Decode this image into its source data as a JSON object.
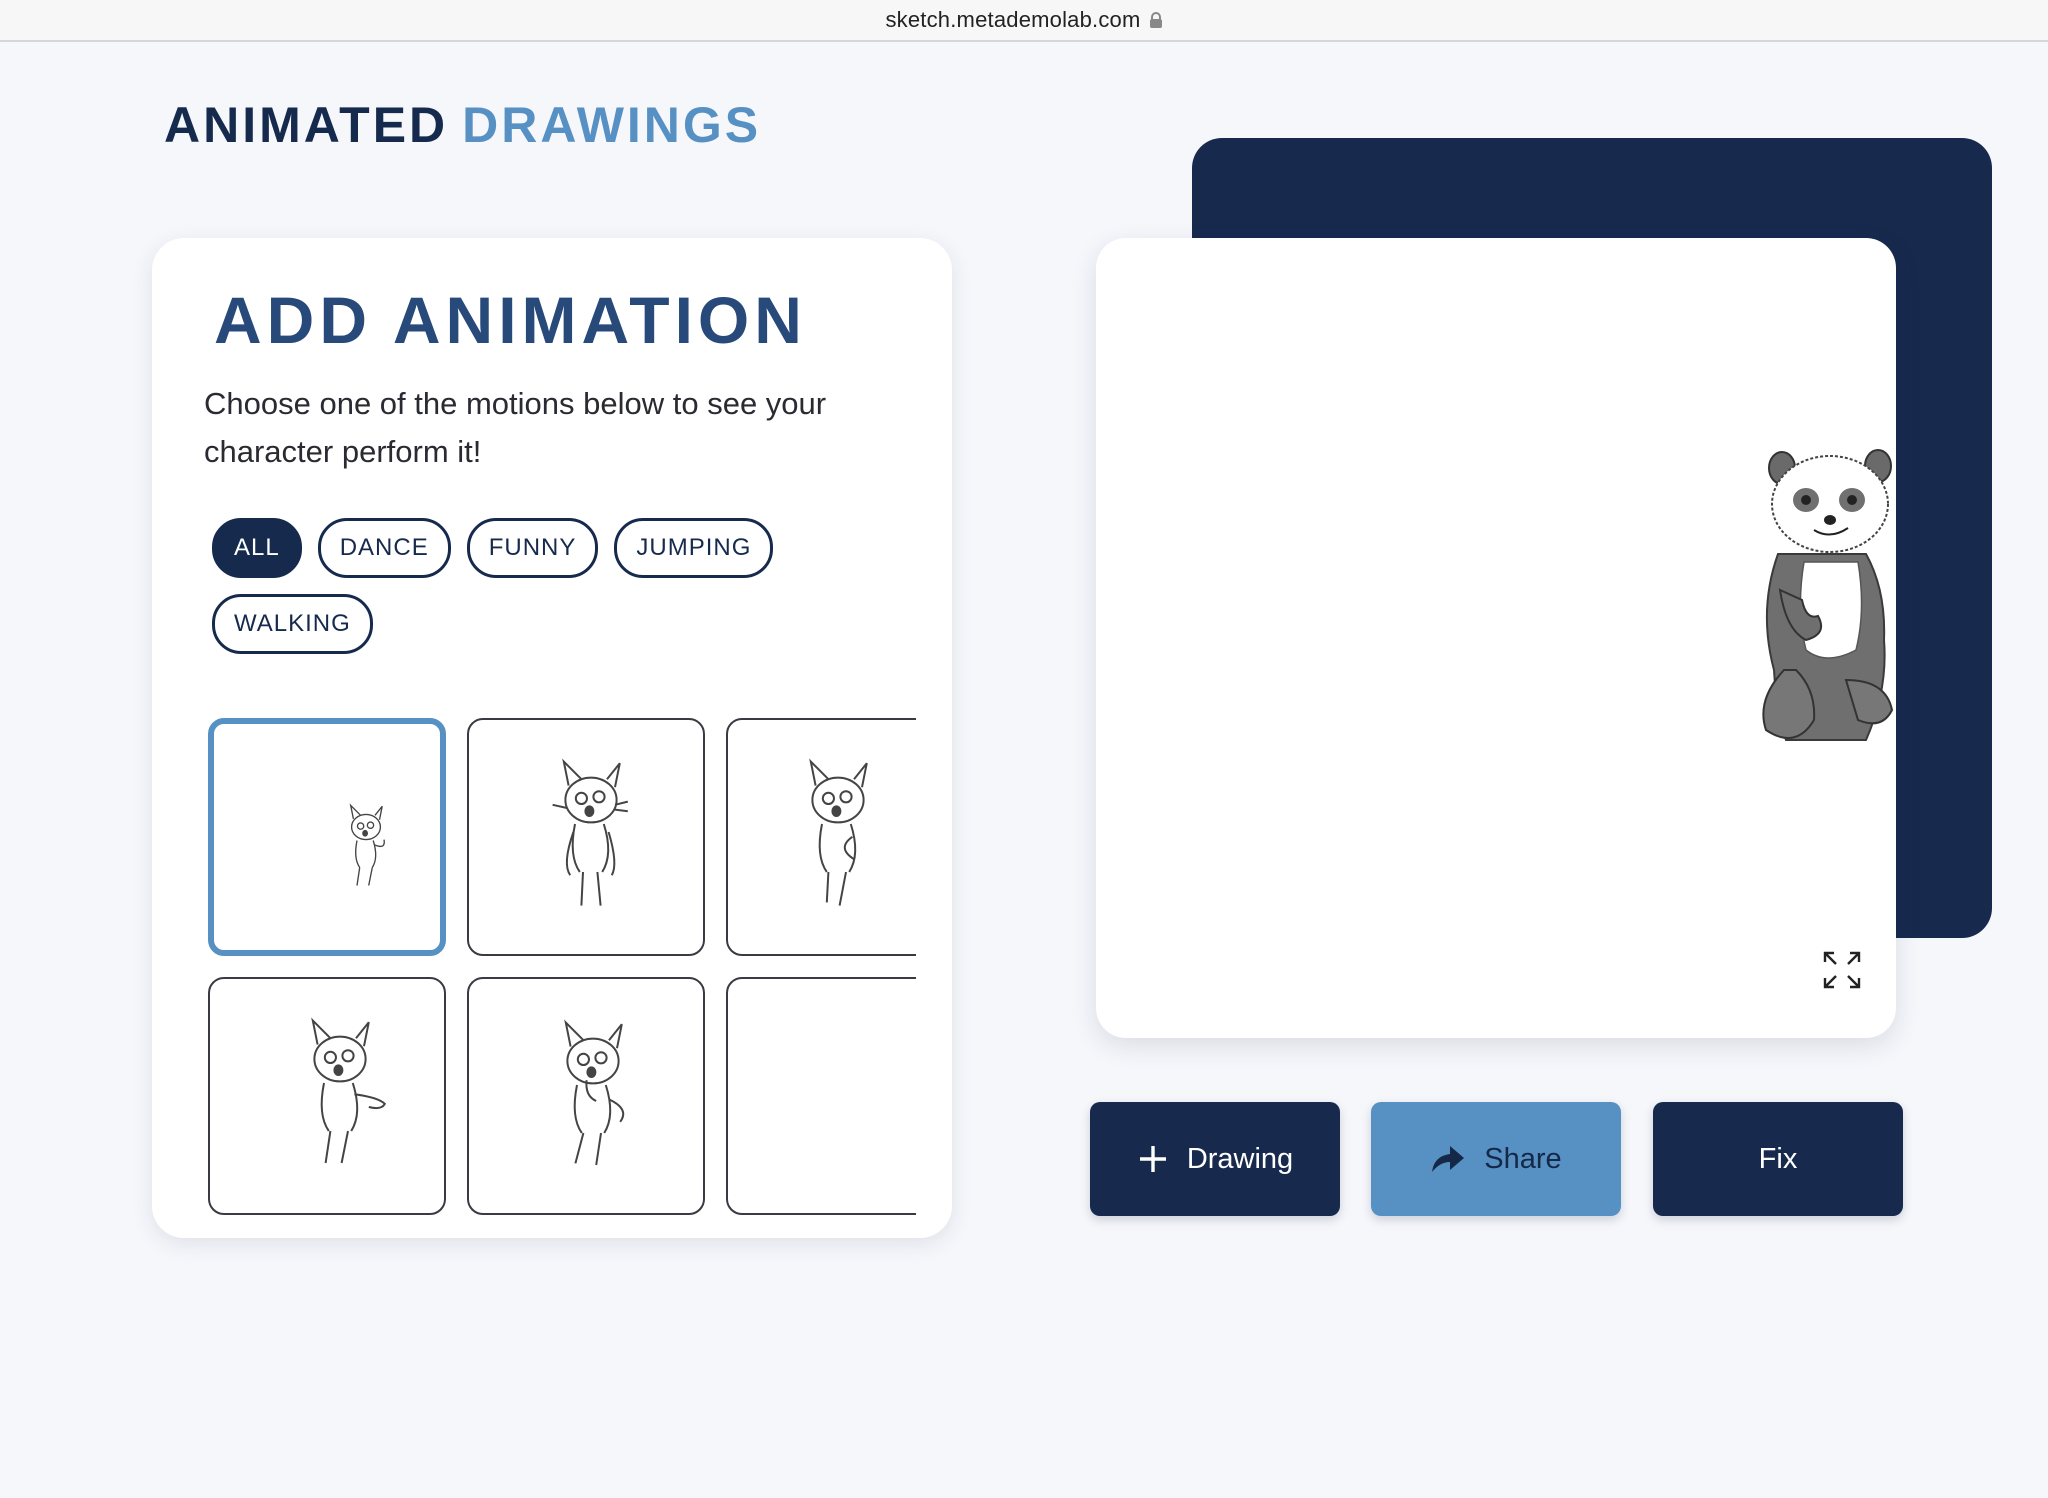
{
  "browser": {
    "url": "sketch.metademolab.com"
  },
  "brand": {
    "part1": "ANIMATED",
    "part2": "DRAWINGS"
  },
  "panel": {
    "title": "ADD ANIMATION",
    "description": "Choose one of the motions below to see your character perform it!",
    "filters": [
      {
        "label": "ALL",
        "active": true
      },
      {
        "label": "DANCE",
        "active": false
      },
      {
        "label": "FUNNY",
        "active": false
      },
      {
        "label": "JUMPING",
        "active": false
      },
      {
        "label": "WALKING",
        "active": false
      }
    ],
    "selected_thumbnail": 1
  },
  "actions": {
    "add_drawing_label": "Drawing",
    "share_label": "Share",
    "fix_label": "Fix"
  },
  "colors": {
    "navy": "#172a4e",
    "accent_blue": "#5791c4",
    "title_blue": "#274a7a",
    "background": "#f6f7fb"
  },
  "icons": [
    "lock-icon",
    "expand-icon",
    "plus-icon",
    "share-arrow-icon"
  ]
}
